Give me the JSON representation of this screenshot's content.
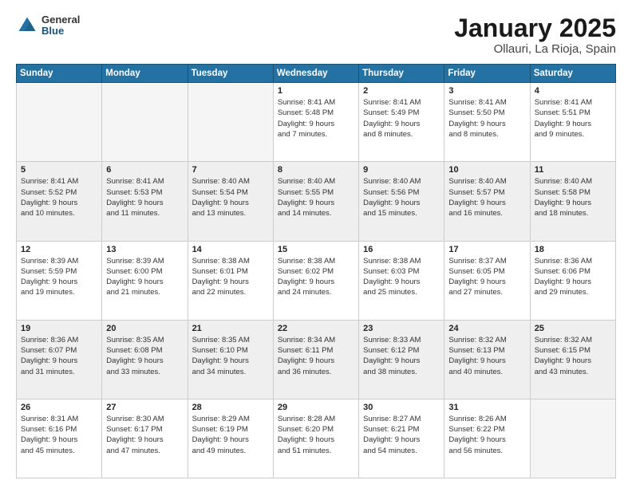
{
  "logo": {
    "general": "General",
    "blue": "Blue"
  },
  "header": {
    "title": "January 2025",
    "location": "Ollauri, La Rioja, Spain"
  },
  "weekdays": [
    "Sunday",
    "Monday",
    "Tuesday",
    "Wednesday",
    "Thursday",
    "Friday",
    "Saturday"
  ],
  "weeks": [
    [
      {
        "day": "",
        "info": ""
      },
      {
        "day": "",
        "info": ""
      },
      {
        "day": "",
        "info": ""
      },
      {
        "day": "1",
        "info": "Sunrise: 8:41 AM\nSunset: 5:48 PM\nDaylight: 9 hours and 7 minutes."
      },
      {
        "day": "2",
        "info": "Sunrise: 8:41 AM\nSunset: 5:49 PM\nDaylight: 9 hours and 8 minutes."
      },
      {
        "day": "3",
        "info": "Sunrise: 8:41 AM\nSunset: 5:50 PM\nDaylight: 9 hours and 8 minutes."
      },
      {
        "day": "4",
        "info": "Sunrise: 8:41 AM\nSunset: 5:51 PM\nDaylight: 9 hours and 9 minutes."
      }
    ],
    [
      {
        "day": "5",
        "info": "Sunrise: 8:41 AM\nSunset: 5:52 PM\nDaylight: 9 hours and 10 minutes."
      },
      {
        "day": "6",
        "info": "Sunrise: 8:41 AM\nSunset: 5:53 PM\nDaylight: 9 hours and 11 minutes."
      },
      {
        "day": "7",
        "info": "Sunrise: 8:40 AM\nSunset: 5:54 PM\nDaylight: 9 hours and 13 minutes."
      },
      {
        "day": "8",
        "info": "Sunrise: 8:40 AM\nSunset: 5:55 PM\nDaylight: 9 hours and 14 minutes."
      },
      {
        "day": "9",
        "info": "Sunrise: 8:40 AM\nSunset: 5:56 PM\nDaylight: 9 hours and 15 minutes."
      },
      {
        "day": "10",
        "info": "Sunrise: 8:40 AM\nSunset: 5:57 PM\nDaylight: 9 hours and 16 minutes."
      },
      {
        "day": "11",
        "info": "Sunrise: 8:40 AM\nSunset: 5:58 PM\nDaylight: 9 hours and 18 minutes."
      }
    ],
    [
      {
        "day": "12",
        "info": "Sunrise: 8:39 AM\nSunset: 5:59 PM\nDaylight: 9 hours and 19 minutes."
      },
      {
        "day": "13",
        "info": "Sunrise: 8:39 AM\nSunset: 6:00 PM\nDaylight: 9 hours and 21 minutes."
      },
      {
        "day": "14",
        "info": "Sunrise: 8:38 AM\nSunset: 6:01 PM\nDaylight: 9 hours and 22 minutes."
      },
      {
        "day": "15",
        "info": "Sunrise: 8:38 AM\nSunset: 6:02 PM\nDaylight: 9 hours and 24 minutes."
      },
      {
        "day": "16",
        "info": "Sunrise: 8:38 AM\nSunset: 6:03 PM\nDaylight: 9 hours and 25 minutes."
      },
      {
        "day": "17",
        "info": "Sunrise: 8:37 AM\nSunset: 6:05 PM\nDaylight: 9 hours and 27 minutes."
      },
      {
        "day": "18",
        "info": "Sunrise: 8:36 AM\nSunset: 6:06 PM\nDaylight: 9 hours and 29 minutes."
      }
    ],
    [
      {
        "day": "19",
        "info": "Sunrise: 8:36 AM\nSunset: 6:07 PM\nDaylight: 9 hours and 31 minutes."
      },
      {
        "day": "20",
        "info": "Sunrise: 8:35 AM\nSunset: 6:08 PM\nDaylight: 9 hours and 33 minutes."
      },
      {
        "day": "21",
        "info": "Sunrise: 8:35 AM\nSunset: 6:10 PM\nDaylight: 9 hours and 34 minutes."
      },
      {
        "day": "22",
        "info": "Sunrise: 8:34 AM\nSunset: 6:11 PM\nDaylight: 9 hours and 36 minutes."
      },
      {
        "day": "23",
        "info": "Sunrise: 8:33 AM\nSunset: 6:12 PM\nDaylight: 9 hours and 38 minutes."
      },
      {
        "day": "24",
        "info": "Sunrise: 8:32 AM\nSunset: 6:13 PM\nDaylight: 9 hours and 40 minutes."
      },
      {
        "day": "25",
        "info": "Sunrise: 8:32 AM\nSunset: 6:15 PM\nDaylight: 9 hours and 43 minutes."
      }
    ],
    [
      {
        "day": "26",
        "info": "Sunrise: 8:31 AM\nSunset: 6:16 PM\nDaylight: 9 hours and 45 minutes."
      },
      {
        "day": "27",
        "info": "Sunrise: 8:30 AM\nSunset: 6:17 PM\nDaylight: 9 hours and 47 minutes."
      },
      {
        "day": "28",
        "info": "Sunrise: 8:29 AM\nSunset: 6:19 PM\nDaylight: 9 hours and 49 minutes."
      },
      {
        "day": "29",
        "info": "Sunrise: 8:28 AM\nSunset: 6:20 PM\nDaylight: 9 hours and 51 minutes."
      },
      {
        "day": "30",
        "info": "Sunrise: 8:27 AM\nSunset: 6:21 PM\nDaylight: 9 hours and 54 minutes."
      },
      {
        "day": "31",
        "info": "Sunrise: 8:26 AM\nSunset: 6:22 PM\nDaylight: 9 hours and 56 minutes."
      },
      {
        "day": "",
        "info": ""
      }
    ]
  ]
}
